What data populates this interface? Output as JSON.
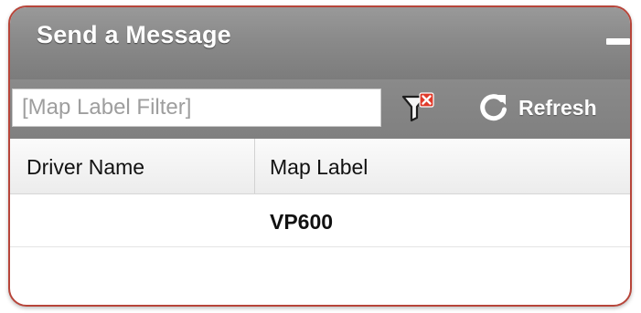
{
  "window": {
    "title": "Send a Message"
  },
  "toolbar": {
    "filter_placeholder": "[Map Label Filter]",
    "filter_value": "",
    "clear_filter_icon": "filter-clear-icon",
    "refresh_icon": "refresh-icon",
    "refresh_label": "Refresh"
  },
  "table": {
    "columns": [
      "Driver Name",
      "Map Label"
    ],
    "rows": [
      {
        "driver_name": "",
        "map_label": "VP600"
      }
    ]
  },
  "colors": {
    "frame_border": "#b7453a",
    "titlebar": "#8a8a8a",
    "clear_badge": "#e03a2a"
  }
}
